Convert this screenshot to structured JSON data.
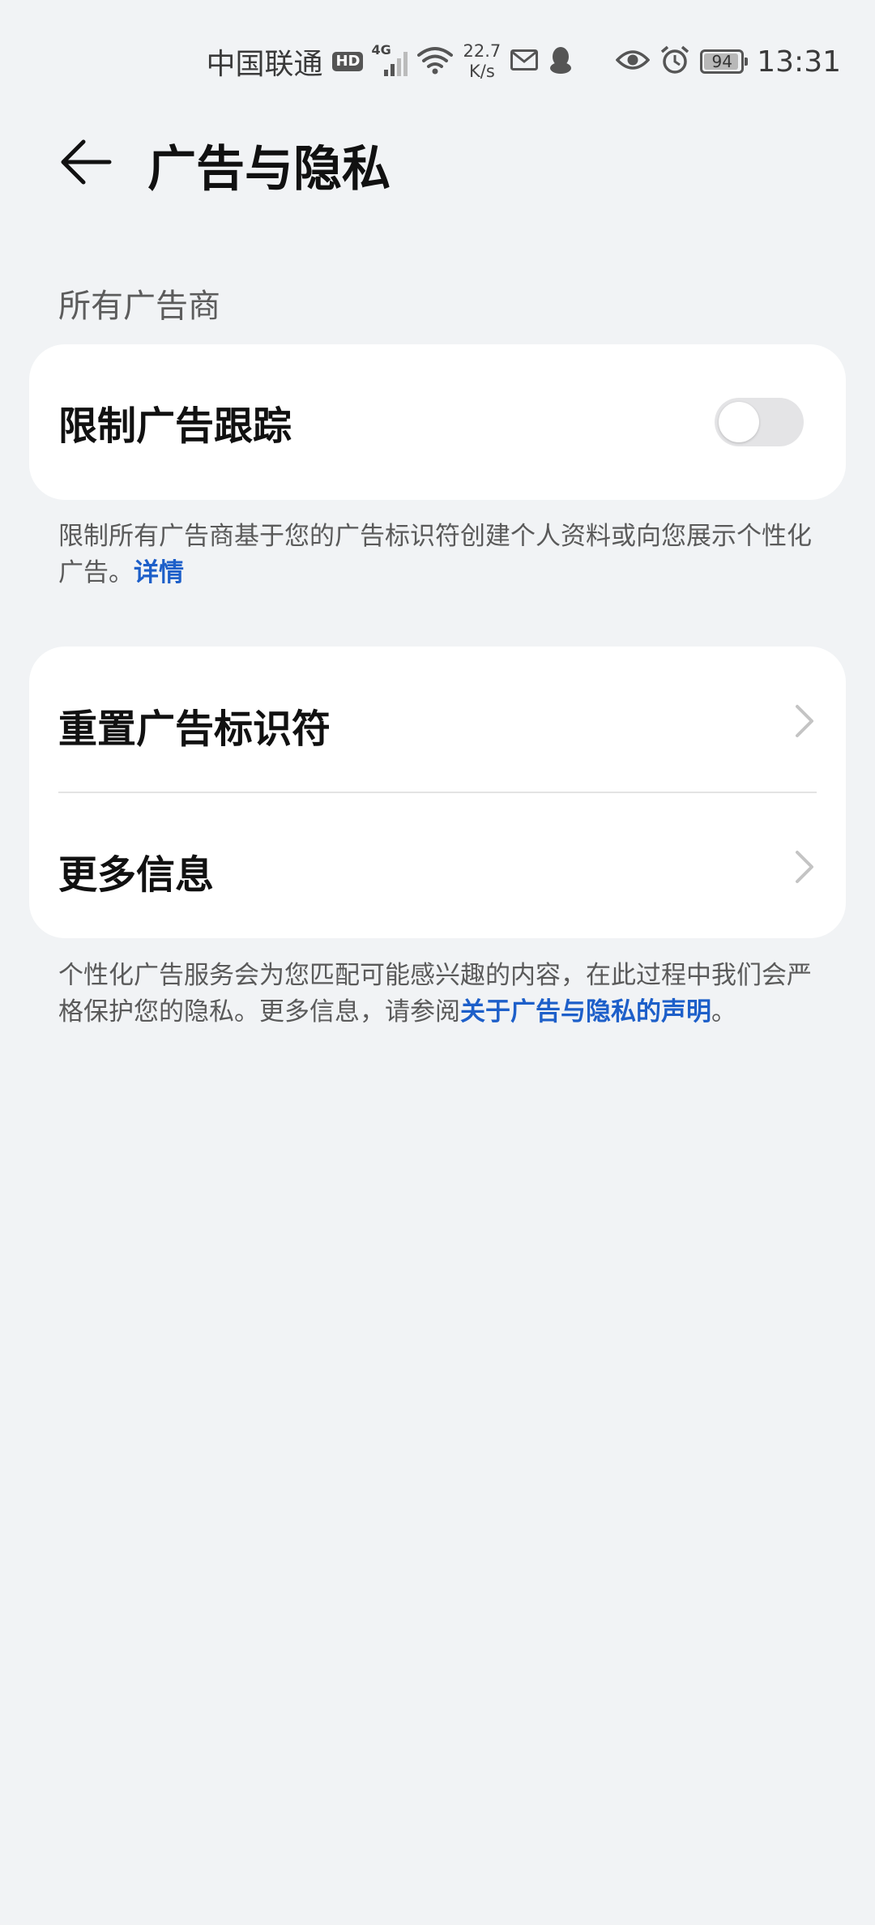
{
  "status_bar": {
    "carrier": "中国联通",
    "hd": "HD",
    "network": "4G",
    "speed_value": "22.7",
    "speed_unit": "K/s",
    "battery": "94",
    "time": "13:31"
  },
  "header": {
    "title": "广告与隐私"
  },
  "section": {
    "label": "所有广告商"
  },
  "limit_tracking": {
    "label": "限制广告跟踪",
    "enabled": false,
    "description": "限制所有广告商基于您的广告标识符创建个人资料或向您展示个性化广告。",
    "details_link": "详情"
  },
  "menu": {
    "items": [
      {
        "label": "重置广告标识符"
      },
      {
        "label": "更多信息"
      }
    ]
  },
  "footer_note": {
    "text": "个性化广告服务会为您匹配可能感兴趣的内容，在此过程中我们会严格保护您的隐私。更多信息，请参阅",
    "link": "关于广告与隐私的声明",
    "suffix": "。"
  },
  "colors": {
    "background": "#f1f3f5",
    "card": "#ffffff",
    "link": "#1d5fc9",
    "toggle_off": "#e4e4e6"
  }
}
